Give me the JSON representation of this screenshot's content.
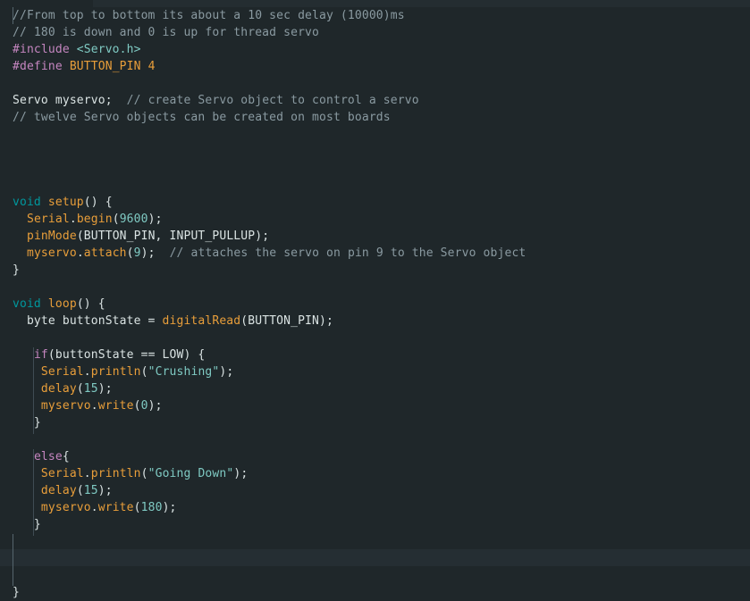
{
  "editor": {
    "lines": [
      {
        "tokens": [
          {
            "t": "comment",
            "v": "//From top to bottom its about a 10 sec delay (10000)ms"
          }
        ]
      },
      {
        "tokens": [
          {
            "t": "comment",
            "v": "// 180 is down and 0 is up for thread servo"
          }
        ]
      },
      {
        "tokens": [
          {
            "t": "pre",
            "v": "#include "
          },
          {
            "t": "header",
            "v": "<Servo.h>"
          }
        ]
      },
      {
        "tokens": [
          {
            "t": "pre",
            "v": "#define "
          },
          {
            "t": "macro",
            "v": "BUTTON_PIN 4"
          }
        ]
      },
      {
        "tokens": []
      },
      {
        "tokens": [
          {
            "t": "plain",
            "v": "Servo myservo;  "
          },
          {
            "t": "comment",
            "v": "// create Servo object to control a servo"
          }
        ]
      },
      {
        "tokens": [
          {
            "t": "comment",
            "v": "// twelve Servo objects can be created on most boards"
          }
        ]
      },
      {
        "tokens": []
      },
      {
        "tokens": []
      },
      {
        "tokens": []
      },
      {
        "tokens": []
      },
      {
        "tokens": [
          {
            "t": "kw",
            "v": "void "
          },
          {
            "t": "func",
            "v": "setup"
          },
          {
            "t": "plain",
            "v": "() {"
          }
        ]
      },
      {
        "tokens": [
          {
            "t": "plain",
            "v": "  "
          },
          {
            "t": "func",
            "v": "Serial"
          },
          {
            "t": "plain",
            "v": "."
          },
          {
            "t": "func",
            "v": "begin"
          },
          {
            "t": "plain",
            "v": "("
          },
          {
            "t": "num",
            "v": "9600"
          },
          {
            "t": "plain",
            "v": ");"
          }
        ]
      },
      {
        "tokens": [
          {
            "t": "plain",
            "v": "  "
          },
          {
            "t": "func",
            "v": "pinMode"
          },
          {
            "t": "plain",
            "v": "(BUTTON_PIN, INPUT_PULLUP);"
          }
        ]
      },
      {
        "tokens": [
          {
            "t": "plain",
            "v": "  "
          },
          {
            "t": "func",
            "v": "myservo"
          },
          {
            "t": "plain",
            "v": "."
          },
          {
            "t": "func",
            "v": "attach"
          },
          {
            "t": "plain",
            "v": "("
          },
          {
            "t": "num",
            "v": "9"
          },
          {
            "t": "plain",
            "v": ");  "
          },
          {
            "t": "comment",
            "v": "// attaches the servo on pin 9 to the Servo object"
          }
        ]
      },
      {
        "tokens": [
          {
            "t": "plain",
            "v": "}"
          }
        ]
      },
      {
        "tokens": []
      },
      {
        "tokens": [
          {
            "t": "kw",
            "v": "void "
          },
          {
            "t": "func",
            "v": "loop"
          },
          {
            "t": "plain",
            "v": "() {"
          }
        ]
      },
      {
        "tokens": [
          {
            "t": "plain",
            "v": "  byte buttonState = "
          },
          {
            "t": "func",
            "v": "digitalRead"
          },
          {
            "t": "plain",
            "v": "(BUTTON_PIN);"
          }
        ]
      },
      {
        "tokens": []
      },
      {
        "tokens": [
          {
            "t": "plain",
            "v": "   "
          },
          {
            "t": "ctrl",
            "v": "if"
          },
          {
            "t": "plain",
            "v": "(buttonState == LOW) {"
          }
        ]
      },
      {
        "tokens": [
          {
            "t": "plain",
            "v": "    "
          },
          {
            "t": "func",
            "v": "Serial"
          },
          {
            "t": "plain",
            "v": "."
          },
          {
            "t": "func",
            "v": "println"
          },
          {
            "t": "plain",
            "v": "("
          },
          {
            "t": "str",
            "v": "\"Crushing\""
          },
          {
            "t": "plain",
            "v": ");"
          }
        ]
      },
      {
        "tokens": [
          {
            "t": "plain",
            "v": "    "
          },
          {
            "t": "func",
            "v": "delay"
          },
          {
            "t": "plain",
            "v": "("
          },
          {
            "t": "num",
            "v": "15"
          },
          {
            "t": "plain",
            "v": ");"
          }
        ]
      },
      {
        "tokens": [
          {
            "t": "plain",
            "v": "    "
          },
          {
            "t": "func",
            "v": "myservo"
          },
          {
            "t": "plain",
            "v": "."
          },
          {
            "t": "func",
            "v": "write"
          },
          {
            "t": "plain",
            "v": "("
          },
          {
            "t": "num",
            "v": "0"
          },
          {
            "t": "plain",
            "v": ");"
          }
        ]
      },
      {
        "tokens": [
          {
            "t": "plain",
            "v": "   }"
          }
        ]
      },
      {
        "tokens": []
      },
      {
        "tokens": [
          {
            "t": "plain",
            "v": "   "
          },
          {
            "t": "ctrl",
            "v": "else"
          },
          {
            "t": "plain",
            "v": "{"
          }
        ]
      },
      {
        "tokens": [
          {
            "t": "plain",
            "v": "    "
          },
          {
            "t": "func",
            "v": "Serial"
          },
          {
            "t": "plain",
            "v": "."
          },
          {
            "t": "func",
            "v": "println"
          },
          {
            "t": "plain",
            "v": "("
          },
          {
            "t": "str",
            "v": "\"Going Down\""
          },
          {
            "t": "plain",
            "v": ");"
          }
        ]
      },
      {
        "tokens": [
          {
            "t": "plain",
            "v": "    "
          },
          {
            "t": "func",
            "v": "delay"
          },
          {
            "t": "plain",
            "v": "("
          },
          {
            "t": "num",
            "v": "15"
          },
          {
            "t": "plain",
            "v": ");"
          }
        ]
      },
      {
        "tokens": [
          {
            "t": "plain",
            "v": "    "
          },
          {
            "t": "func",
            "v": "myservo"
          },
          {
            "t": "plain",
            "v": "."
          },
          {
            "t": "func",
            "v": "write"
          },
          {
            "t": "plain",
            "v": "("
          },
          {
            "t": "num",
            "v": "180"
          },
          {
            "t": "plain",
            "v": ");"
          }
        ]
      },
      {
        "tokens": [
          {
            "t": "plain",
            "v": "   }"
          }
        ]
      },
      {
        "tokens": []
      },
      {
        "tokens": []
      },
      {
        "tokens": []
      },
      {
        "tokens": [
          {
            "t": "plain",
            "v": "}"
          }
        ]
      }
    ]
  }
}
